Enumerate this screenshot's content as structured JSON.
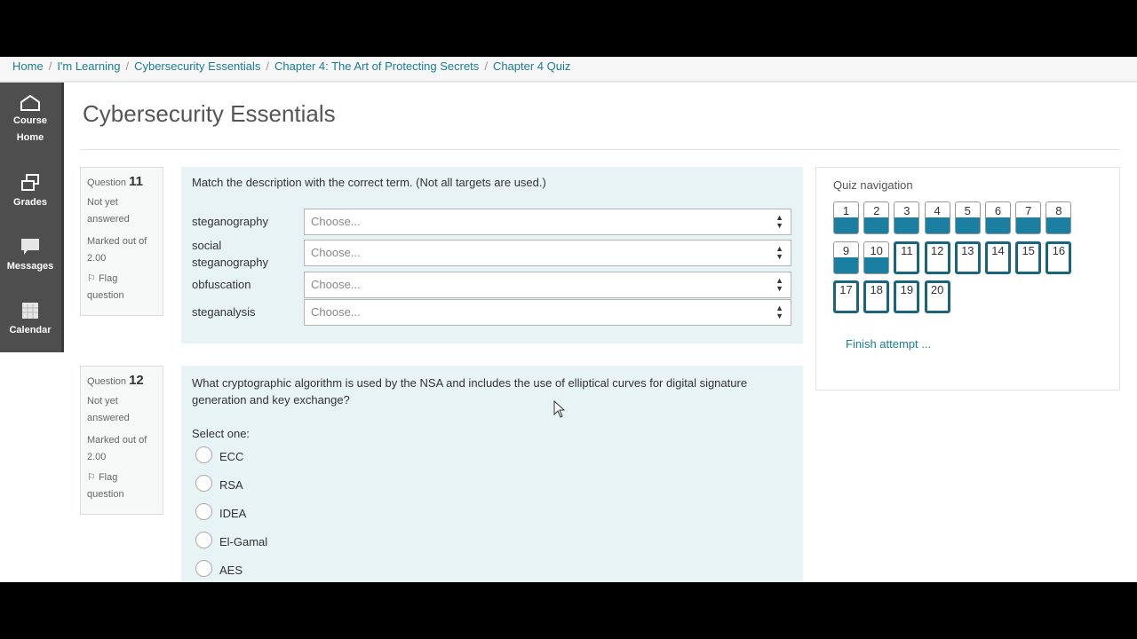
{
  "breadcrumb": [
    "Home",
    "I'm Learning",
    "Cybersecurity Essentials",
    "Chapter 4: The Art of Protecting Secrets",
    "Chapter 4 Quiz"
  ],
  "sidebar": {
    "items": [
      {
        "icon": "home-icon",
        "line1": "Course",
        "line2": "Home"
      },
      {
        "icon": "grades-icon",
        "line1": "Grades"
      },
      {
        "icon": "messages-icon",
        "line1": "Messages"
      },
      {
        "icon": "calendar-icon",
        "line1": "Calendar"
      }
    ]
  },
  "page_title": "Cybersecurity Essentials",
  "questions": [
    {
      "label": "Question",
      "number": "11",
      "status_line1": "Not yet",
      "status_line2": "answered",
      "marked_line1": "Marked out of",
      "marked_line2": "2.00",
      "flag_line1": "Flag",
      "flag_line2": "question",
      "text": "Match the description with the correct term. (Not all targets are used.)",
      "matches": [
        {
          "term": "steganography",
          "value": "Choose..."
        },
        {
          "term": "social steganography",
          "value": "Choose..."
        },
        {
          "term": "obfuscation",
          "value": "Choose..."
        },
        {
          "term": "steganalysis",
          "value": "Choose..."
        }
      ]
    },
    {
      "label": "Question",
      "number": "12",
      "status_line1": "Not yet",
      "status_line2": "answered",
      "marked_line1": "Marked out of",
      "marked_line2": "2.00",
      "flag_line1": "Flag",
      "flag_line2": "question",
      "text": "What cryptographic algorithm is used by the NSA and includes the use of elliptical curves for digital signature generation and key exchange?",
      "prompt": "Select one:",
      "options": [
        "ECC",
        "RSA",
        "IDEA",
        "El-Gamal",
        "AES"
      ]
    }
  ],
  "quiz_navigation": {
    "title": "Quiz navigation",
    "answered": [
      "1",
      "2",
      "3",
      "4",
      "5",
      "6",
      "7",
      "8",
      "9",
      "10"
    ],
    "unanswered": [
      "11",
      "12",
      "13",
      "14",
      "15",
      "16",
      "17",
      "18",
      "19",
      "20"
    ],
    "finish_label": "Finish attempt ..."
  },
  "colors": {
    "accent": "#1a7fa0",
    "link": "#1a7c96",
    "question_bg": "#e7f3f5",
    "sidebar_bg": "#4e4e4e"
  }
}
